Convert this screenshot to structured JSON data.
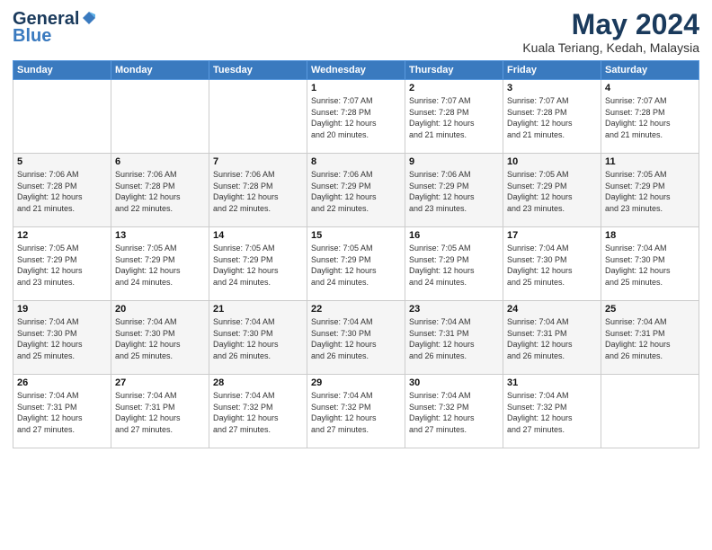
{
  "header": {
    "logo_line1": "General",
    "logo_line2": "Blue",
    "title": "May 2024",
    "subtitle": "Kuala Teriang, Kedah, Malaysia"
  },
  "weekdays": [
    "Sunday",
    "Monday",
    "Tuesday",
    "Wednesday",
    "Thursday",
    "Friday",
    "Saturday"
  ],
  "weeks": [
    [
      {
        "day": "",
        "info": ""
      },
      {
        "day": "",
        "info": ""
      },
      {
        "day": "",
        "info": ""
      },
      {
        "day": "1",
        "info": "Sunrise: 7:07 AM\nSunset: 7:28 PM\nDaylight: 12 hours\nand 20 minutes."
      },
      {
        "day": "2",
        "info": "Sunrise: 7:07 AM\nSunset: 7:28 PM\nDaylight: 12 hours\nand 21 minutes."
      },
      {
        "day": "3",
        "info": "Sunrise: 7:07 AM\nSunset: 7:28 PM\nDaylight: 12 hours\nand 21 minutes."
      },
      {
        "day": "4",
        "info": "Sunrise: 7:07 AM\nSunset: 7:28 PM\nDaylight: 12 hours\nand 21 minutes."
      }
    ],
    [
      {
        "day": "5",
        "info": "Sunrise: 7:06 AM\nSunset: 7:28 PM\nDaylight: 12 hours\nand 21 minutes."
      },
      {
        "day": "6",
        "info": "Sunrise: 7:06 AM\nSunset: 7:28 PM\nDaylight: 12 hours\nand 22 minutes."
      },
      {
        "day": "7",
        "info": "Sunrise: 7:06 AM\nSunset: 7:28 PM\nDaylight: 12 hours\nand 22 minutes."
      },
      {
        "day": "8",
        "info": "Sunrise: 7:06 AM\nSunset: 7:29 PM\nDaylight: 12 hours\nand 22 minutes."
      },
      {
        "day": "9",
        "info": "Sunrise: 7:06 AM\nSunset: 7:29 PM\nDaylight: 12 hours\nand 23 minutes."
      },
      {
        "day": "10",
        "info": "Sunrise: 7:05 AM\nSunset: 7:29 PM\nDaylight: 12 hours\nand 23 minutes."
      },
      {
        "day": "11",
        "info": "Sunrise: 7:05 AM\nSunset: 7:29 PM\nDaylight: 12 hours\nand 23 minutes."
      }
    ],
    [
      {
        "day": "12",
        "info": "Sunrise: 7:05 AM\nSunset: 7:29 PM\nDaylight: 12 hours\nand 23 minutes."
      },
      {
        "day": "13",
        "info": "Sunrise: 7:05 AM\nSunset: 7:29 PM\nDaylight: 12 hours\nand 24 minutes."
      },
      {
        "day": "14",
        "info": "Sunrise: 7:05 AM\nSunset: 7:29 PM\nDaylight: 12 hours\nand 24 minutes."
      },
      {
        "day": "15",
        "info": "Sunrise: 7:05 AM\nSunset: 7:29 PM\nDaylight: 12 hours\nand 24 minutes."
      },
      {
        "day": "16",
        "info": "Sunrise: 7:05 AM\nSunset: 7:29 PM\nDaylight: 12 hours\nand 24 minutes."
      },
      {
        "day": "17",
        "info": "Sunrise: 7:04 AM\nSunset: 7:30 PM\nDaylight: 12 hours\nand 25 minutes."
      },
      {
        "day": "18",
        "info": "Sunrise: 7:04 AM\nSunset: 7:30 PM\nDaylight: 12 hours\nand 25 minutes."
      }
    ],
    [
      {
        "day": "19",
        "info": "Sunrise: 7:04 AM\nSunset: 7:30 PM\nDaylight: 12 hours\nand 25 minutes."
      },
      {
        "day": "20",
        "info": "Sunrise: 7:04 AM\nSunset: 7:30 PM\nDaylight: 12 hours\nand 25 minutes."
      },
      {
        "day": "21",
        "info": "Sunrise: 7:04 AM\nSunset: 7:30 PM\nDaylight: 12 hours\nand 26 minutes."
      },
      {
        "day": "22",
        "info": "Sunrise: 7:04 AM\nSunset: 7:30 PM\nDaylight: 12 hours\nand 26 minutes."
      },
      {
        "day": "23",
        "info": "Sunrise: 7:04 AM\nSunset: 7:31 PM\nDaylight: 12 hours\nand 26 minutes."
      },
      {
        "day": "24",
        "info": "Sunrise: 7:04 AM\nSunset: 7:31 PM\nDaylight: 12 hours\nand 26 minutes."
      },
      {
        "day": "25",
        "info": "Sunrise: 7:04 AM\nSunset: 7:31 PM\nDaylight: 12 hours\nand 26 minutes."
      }
    ],
    [
      {
        "day": "26",
        "info": "Sunrise: 7:04 AM\nSunset: 7:31 PM\nDaylight: 12 hours\nand 27 minutes."
      },
      {
        "day": "27",
        "info": "Sunrise: 7:04 AM\nSunset: 7:31 PM\nDaylight: 12 hours\nand 27 minutes."
      },
      {
        "day": "28",
        "info": "Sunrise: 7:04 AM\nSunset: 7:32 PM\nDaylight: 12 hours\nand 27 minutes."
      },
      {
        "day": "29",
        "info": "Sunrise: 7:04 AM\nSunset: 7:32 PM\nDaylight: 12 hours\nand 27 minutes."
      },
      {
        "day": "30",
        "info": "Sunrise: 7:04 AM\nSunset: 7:32 PM\nDaylight: 12 hours\nand 27 minutes."
      },
      {
        "day": "31",
        "info": "Sunrise: 7:04 AM\nSunset: 7:32 PM\nDaylight: 12 hours\nand 27 minutes."
      },
      {
        "day": "",
        "info": ""
      }
    ]
  ]
}
